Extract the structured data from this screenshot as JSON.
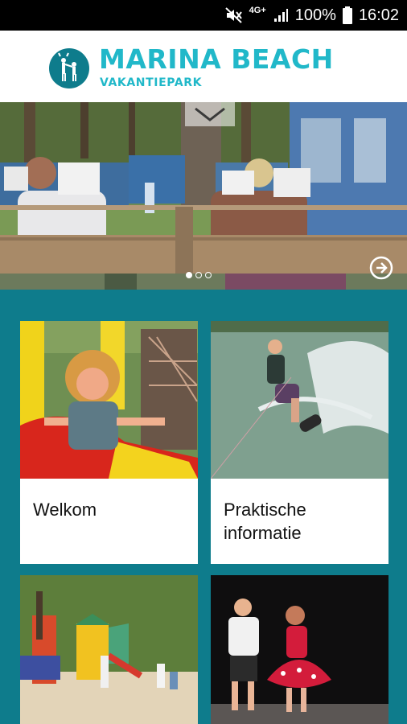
{
  "status_bar": {
    "network": "4G+",
    "battery": "100%",
    "time": "16:02"
  },
  "header": {
    "title": "MARINA BEACH",
    "subtitle": "VAKANTIEPARK"
  },
  "carousel": {
    "slide_count": 3,
    "active_index": 0
  },
  "tiles": [
    {
      "label": "Welkom"
    },
    {
      "label": "Praktische informatie"
    },
    {
      "label": ""
    },
    {
      "label": ""
    }
  ],
  "colors": {
    "brand_teal": "#0e7c8c",
    "logo_cyan": "#21b8c9"
  }
}
